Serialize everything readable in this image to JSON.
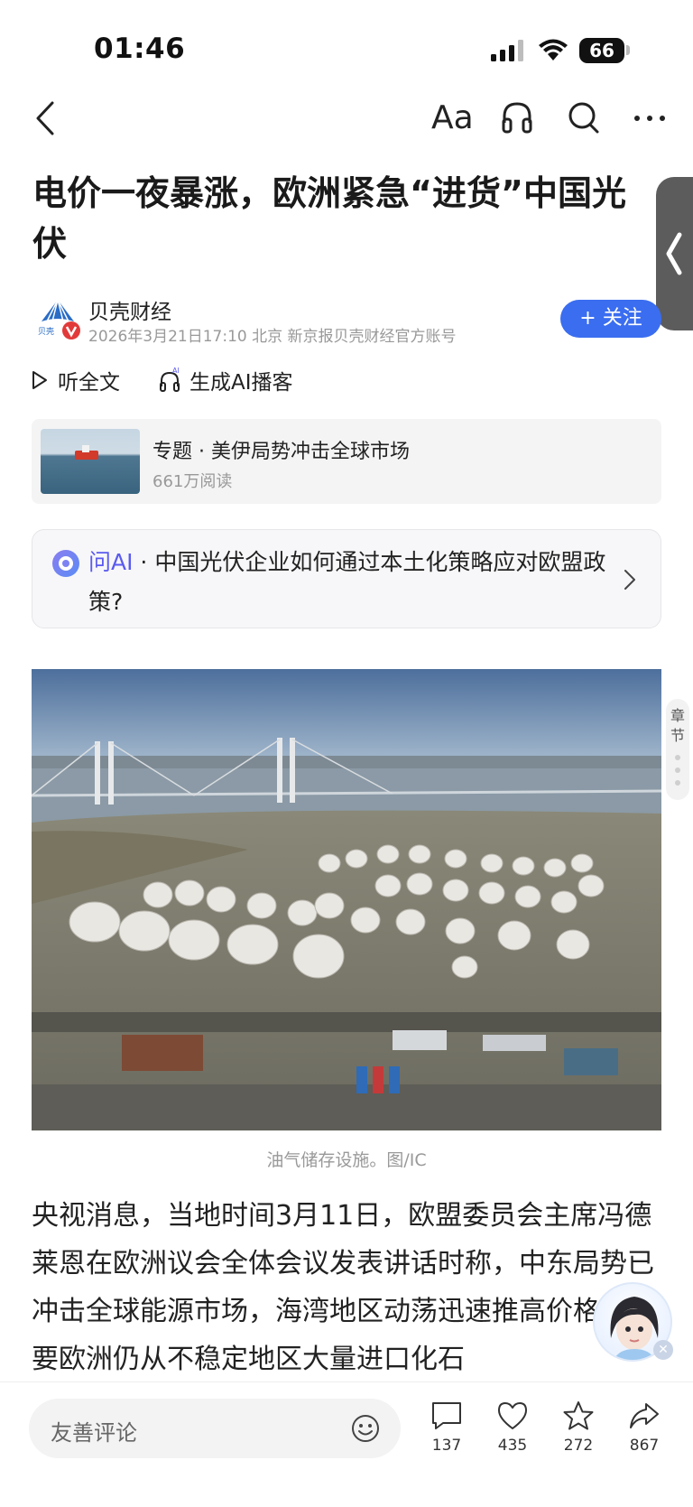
{
  "status_bar": {
    "time": "01:46",
    "battery": "66"
  },
  "nav": {
    "font_label": "Aa"
  },
  "article": {
    "title": "电价一夜暴涨，欧洲紧急“进货”中国光伏",
    "author": "贝壳财经",
    "author_logo_text": "贝壳",
    "meta": "2026年3月21日17:10 北京 新京报贝壳财经官方账号",
    "follow_label": "+ 关注",
    "listen_label": "听全文",
    "podcast_ai_badge": "AI",
    "podcast_label": "生成AI播客"
  },
  "topic": {
    "title": "专题 · 美伊局势冲击全球市场",
    "reads": "661万阅读"
  },
  "ask_ai": {
    "brand": "问AI",
    "separator": " · ",
    "question": "中国光伏企业如何通过本土化策略应对欧盟政策?"
  },
  "chapter_nav": {
    "label": "章节"
  },
  "photo": {
    "caption": "油气储存设施。图/IC"
  },
  "body": {
    "paragraph": "央视消息，当地时间3月11日，欧盟委员会主席冯德莱恩在欧洲议会全体会议发表讲话时称，中东局势已冲击全球能源市场，海湾地区动荡迅速推高价格，只要欧洲仍从不稳定地区大量进口化石"
  },
  "bottom_bar": {
    "comment_placeholder": "友善评论",
    "comments": "137",
    "likes": "435",
    "favorites": "272",
    "shares": "867"
  }
}
